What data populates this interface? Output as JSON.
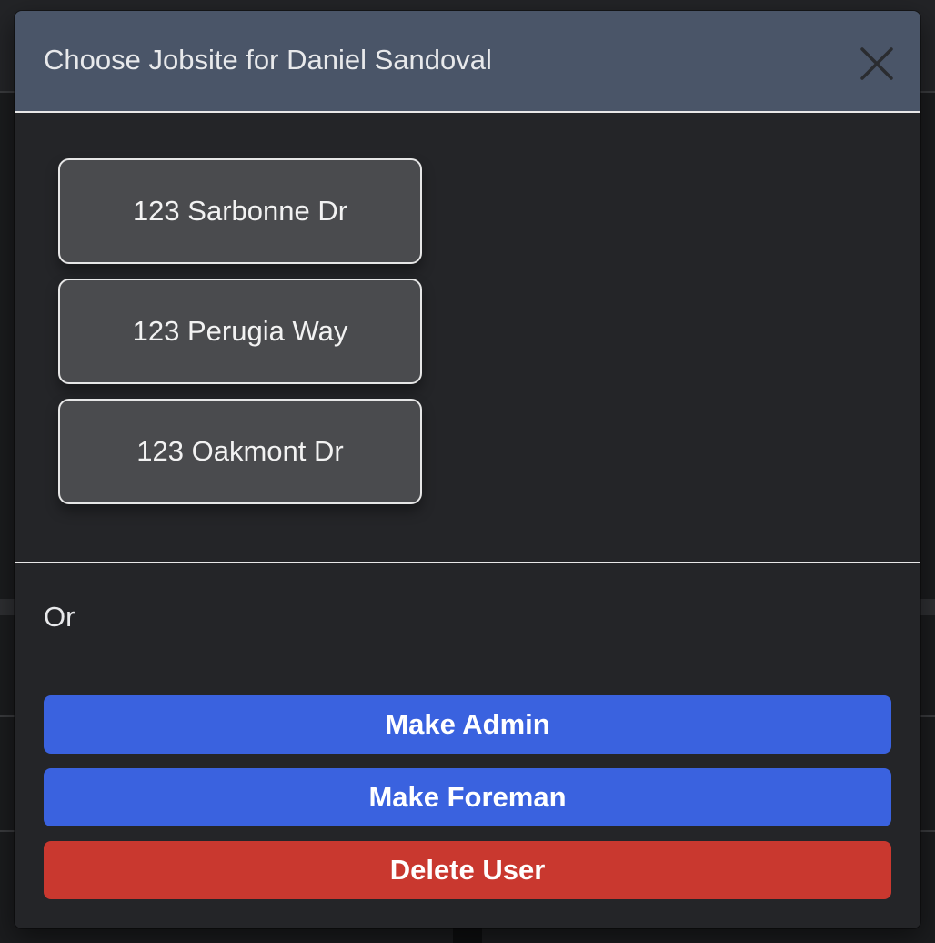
{
  "modal": {
    "title": "Choose Jobsite for Daniel Sandoval",
    "close_icon": "close-icon"
  },
  "jobsites": [
    {
      "label": "123 Sarbonne Dr"
    },
    {
      "label": "123 Perugia Way"
    },
    {
      "label": "123 Oakmont Dr"
    }
  ],
  "or_label": "Or",
  "actions": {
    "make_admin": "Make Admin",
    "make_foreman": "Make Foreman",
    "delete_user": "Delete User"
  },
  "colors": {
    "header_bg": "#4a5568",
    "primary": "#3a62df",
    "danger": "#c9382f",
    "modal_bg": "#242528",
    "jobsite_bg": "#4a4b4e"
  }
}
